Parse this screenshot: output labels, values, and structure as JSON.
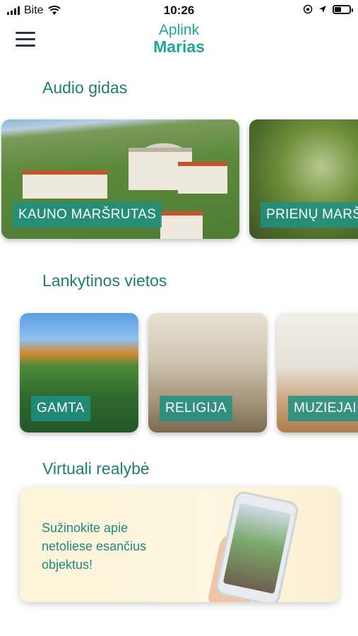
{
  "status_bar": {
    "carrier": "Bite",
    "time": "10:26"
  },
  "header": {
    "logo_line1": "Aplink",
    "logo_line2": "Marias"
  },
  "sections": {
    "audio": {
      "title": "Audio gidas",
      "cards": [
        {
          "label": "KAUNO MARŠRUTAS"
        },
        {
          "label": "PRIENŲ MARŠ"
        }
      ]
    },
    "places": {
      "title": "Lankytinos vietos",
      "cards": [
        {
          "label": "GAMTA"
        },
        {
          "label": "RELIGIJA"
        },
        {
          "label": "MUZIEJAI"
        }
      ]
    },
    "vr": {
      "title": "Virtuali realybė",
      "text": "Sužinokite apie netoliese esančius objektus!"
    }
  },
  "colors": {
    "accent": "#1e8a80",
    "logo": "#20a493",
    "label_bg": "#1e9182"
  }
}
